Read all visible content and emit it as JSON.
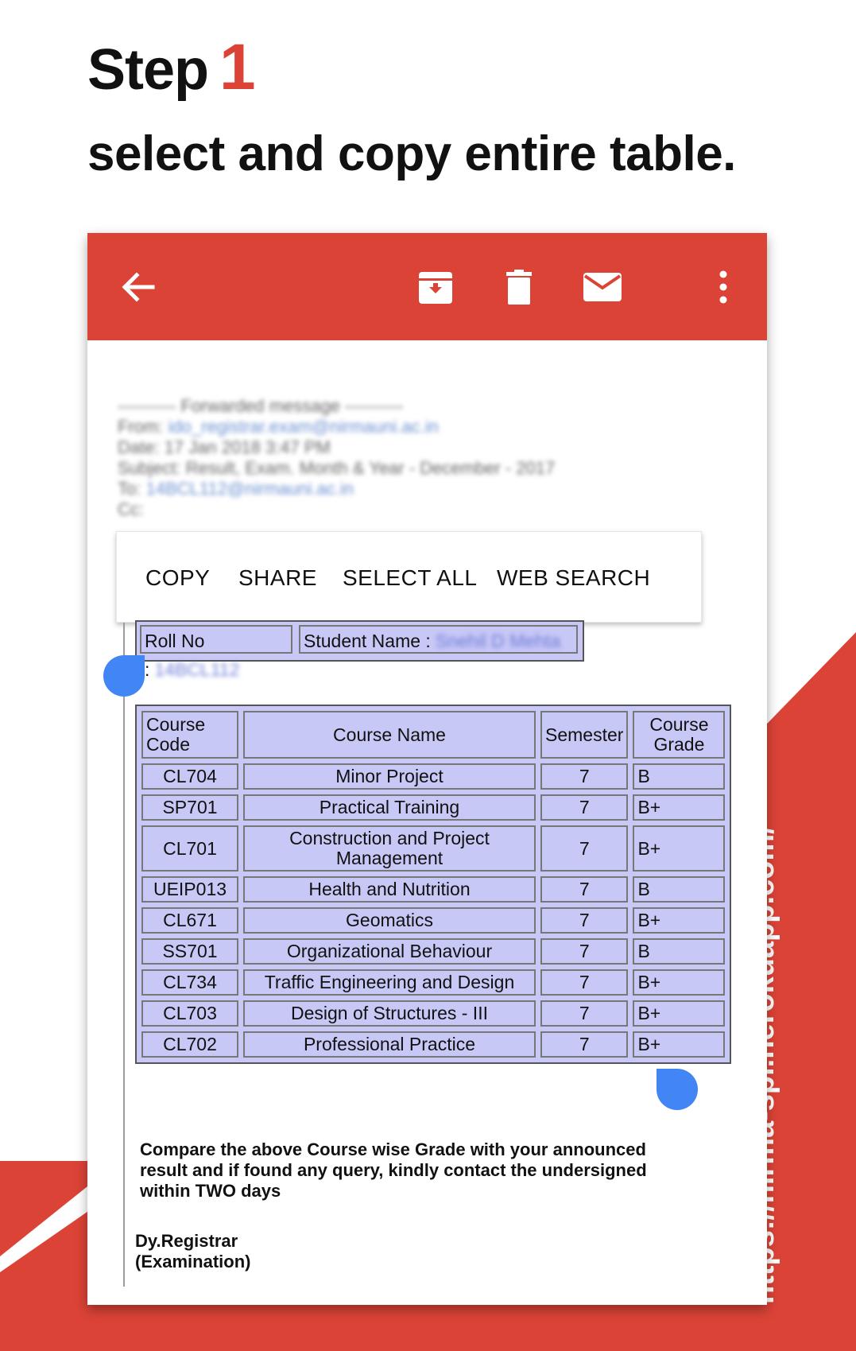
{
  "heading": {
    "step_word": "Step",
    "step_number": "1",
    "subtitle": "select and copy entire table."
  },
  "side_url": "https://nirma-spi.herokuapp.com/",
  "colors": {
    "accent": "#dc4337",
    "selection": "#c8c8f6",
    "handle": "#4285f4"
  },
  "toolbar": {
    "icons": [
      "back-arrow-icon",
      "archive-icon",
      "delete-icon",
      "mail-icon",
      "more-vert-icon"
    ]
  },
  "email": {
    "forwarded_header": "---------- Forwarded message ----------",
    "from": "From: ",
    "from_value": "ido_registrar.exam@nirmauni.ac.in",
    "date": "Date: 17 Jan 2018 3:47 PM",
    "subject": "Subject: Result, Exam. Month & Year - December - 2017",
    "to": "To: ",
    "to_value": "14BCL112@nirmauni.ac.in",
    "cc": "Cc:"
  },
  "context_menu": {
    "copy": "COPY",
    "share": "SHARE",
    "select_all": "SELECT ALL",
    "web_search": "WEB SEARCH"
  },
  "student": {
    "roll_label": "Roll No :",
    "roll_value": "14BCL112",
    "name_label": "Student Name :",
    "name_value": "Snehil D Mehta"
  },
  "table": {
    "headers": {
      "code": "Course Code",
      "name": "Course Name",
      "semester": "Semester",
      "grade": "Course Grade"
    },
    "rows": [
      {
        "code": "CL704",
        "name": "Minor Project",
        "semester": "7",
        "grade": "B"
      },
      {
        "code": "SP701",
        "name": "Practical Training",
        "semester": "7",
        "grade": "B+"
      },
      {
        "code": "CL701",
        "name": "Construction and Project Management",
        "semester": "7",
        "grade": "B+"
      },
      {
        "code": "UEIP013",
        "name": "Health and Nutrition",
        "semester": "7",
        "grade": "B"
      },
      {
        "code": "CL671",
        "name": "Geomatics",
        "semester": "7",
        "grade": "B+"
      },
      {
        "code": "SS701",
        "name": "Organizational Behaviour",
        "semester": "7",
        "grade": "B"
      },
      {
        "code": "CL734",
        "name": "Traffic Engineering and Design",
        "semester": "7",
        "grade": "B+"
      },
      {
        "code": "CL703",
        "name": "Design of Structures - III",
        "semester": "7",
        "grade": "B+"
      },
      {
        "code": "CL702",
        "name": "Professional Practice",
        "semester": "7",
        "grade": "B+"
      }
    ]
  },
  "notice": "Compare the above Course wise Grade with your announced result and if found any query, kindly contact the undersigned within TWO days",
  "signature": {
    "line1": "Dy.Registrar",
    "line2": "(Examination)"
  }
}
